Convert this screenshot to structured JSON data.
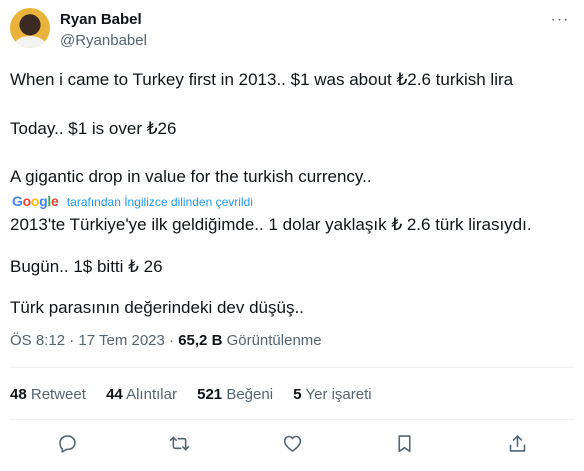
{
  "author": {
    "name": "Ryan Babel",
    "handle": "@Ryanbabel"
  },
  "tweet": {
    "lines": [
      "When i came to Turkey first in 2013.. $1 was about ₺2.6 turkish lira",
      "Today.. $1 is over ₺26",
      "A gigantic drop in value for the turkish currency.."
    ],
    "translation_notice": "tarafından İngilizce dilinden çevrildi",
    "translated_lines": [
      "2013'te Türkiye'ye ilk geldiğimde.. 1 dolar yaklaşık ₺ 2.6 türk lirasıydı.",
      "Bugün.. 1$ bitti ₺ 26",
      "Türk parasının değerindeki dev düşüş.."
    ]
  },
  "meta": {
    "time": "ÖS 8:12",
    "separator": "·",
    "date": "17 Tem 2023",
    "views_count": "65,2 B",
    "views_label": "Görüntülenme"
  },
  "stats": [
    {
      "count": "48",
      "label": "Retweet"
    },
    {
      "count": "44",
      "label": "Alıntılar"
    },
    {
      "count": "521",
      "label": "Beğeni"
    },
    {
      "count": "5",
      "label": "Yer işareti"
    }
  ],
  "icons": [
    "more-icon",
    "reply-icon",
    "retweet-icon",
    "like-icon",
    "bookmark-icon",
    "share-icon"
  ],
  "colors": {
    "text": "#0f1419",
    "secondary": "#536471",
    "link": "#1d9bf0",
    "divider": "#eff3f4"
  }
}
